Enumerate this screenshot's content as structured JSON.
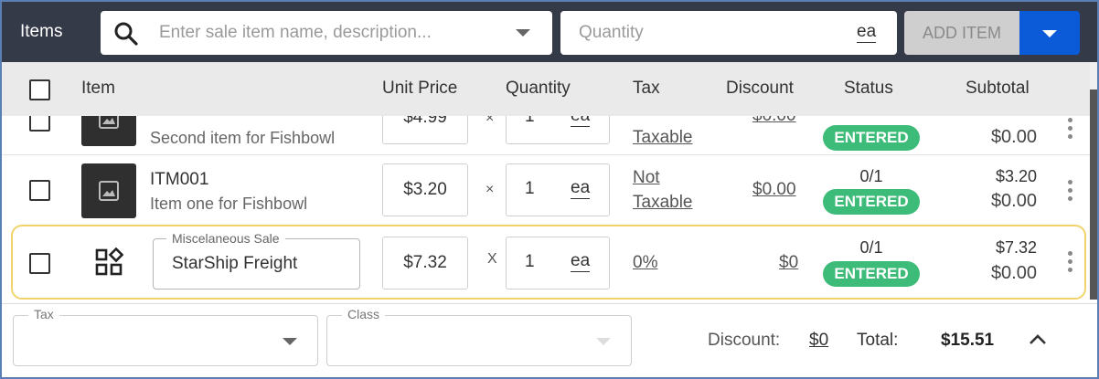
{
  "header_bar": {
    "title": "Items",
    "search_placeholder": "Enter sale item name, description...",
    "quantity_placeholder": "Quantity",
    "quantity_unit": "ea",
    "add_item_label": "ADD ITEM"
  },
  "columns": [
    "Item",
    "Unit Price",
    "Quantity",
    "Tax",
    "Discount",
    "Status",
    "Subtotal"
  ],
  "rows": [
    {
      "name": "",
      "description": "Second item for Fishbowl",
      "price": "$4.99",
      "times": "×",
      "qty": "1",
      "unit": "ea",
      "tax": "Taxable",
      "discount": "$0.00",
      "status_fraction": "",
      "status": "ENTERED",
      "line_total": "",
      "subtotal": "$0.00"
    },
    {
      "name": "ITM001",
      "description": "Item one for Fishbowl",
      "price": "$3.20",
      "times": "×",
      "qty": "1",
      "unit": "ea",
      "tax_line1": "Not",
      "tax_line2": "Taxable",
      "discount": "$0.00",
      "status_fraction": "0/1",
      "status": "ENTERED",
      "line_total": "$3.20",
      "subtotal": "$0.00"
    },
    {
      "field_label": "Miscelaneous Sale",
      "name": "StarShip Freight",
      "price": "$7.32",
      "times": "X",
      "qty": "1",
      "unit": "ea",
      "tax": "0%",
      "discount": "$0",
      "status_fraction": "0/1",
      "status": "ENTERED",
      "line_total": "$7.32",
      "subtotal": "$0.00"
    }
  ],
  "footer": {
    "tax_label": "Tax",
    "class_label": "Class",
    "discount_label": "Discount:",
    "discount_value": "$0",
    "total_label": "Total:",
    "total_value": "$15.51"
  },
  "colors": {
    "topbar": "#343a48",
    "primary": "#0b5bd8",
    "status_green": "#3dbb78",
    "highlight": "#f0d36a"
  }
}
